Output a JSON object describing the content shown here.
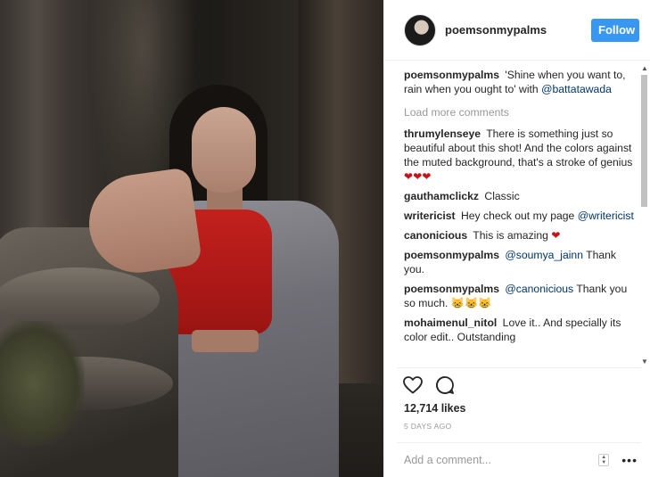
{
  "header": {
    "username": "poemsonmypalms",
    "follow_label": "Follow"
  },
  "comments": [
    {
      "user": "poemsonmypalms",
      "text": "'Shine when you want to, rain when you ought to' with",
      "mention": "@battatawada"
    },
    {
      "type": "load_more",
      "label": "Load more comments"
    },
    {
      "user": "thrumylenseye",
      "text": "There is something just so beautiful about this shot! And the colors against the muted background, that's a stroke of genius",
      "suffix": "❤❤❤"
    },
    {
      "user": "gauthamclickz",
      "text": "Classic"
    },
    {
      "user": "writericist",
      "text": "Hey check out my page",
      "mention": "@writericist"
    },
    {
      "user": "canonicious",
      "text": "This is amazing",
      "suffix": "❤"
    },
    {
      "user": "poemsonmypalms",
      "mention_first": "@soumya_jainn",
      "text": "Thank you."
    },
    {
      "user": "poemsonmypalms",
      "mention_first": "@canonicious",
      "text": "Thank you so much. 😸😸😸"
    },
    {
      "user": "mohaimenul_nitol",
      "text": "Love it.. And specially its color edit.. Outstanding"
    }
  ],
  "post": {
    "likes": "12,714 likes",
    "time_ago": "5 DAYS AGO"
  },
  "add_comment": {
    "placeholder": "Add a comment..."
  },
  "icons": [
    "heart-icon",
    "comment-icon",
    "sort-icon",
    "more-icon"
  ],
  "colors": {
    "accent": "#3897f0",
    "mention": "#003569",
    "heart": "#c3141a",
    "muted": "#999999"
  }
}
